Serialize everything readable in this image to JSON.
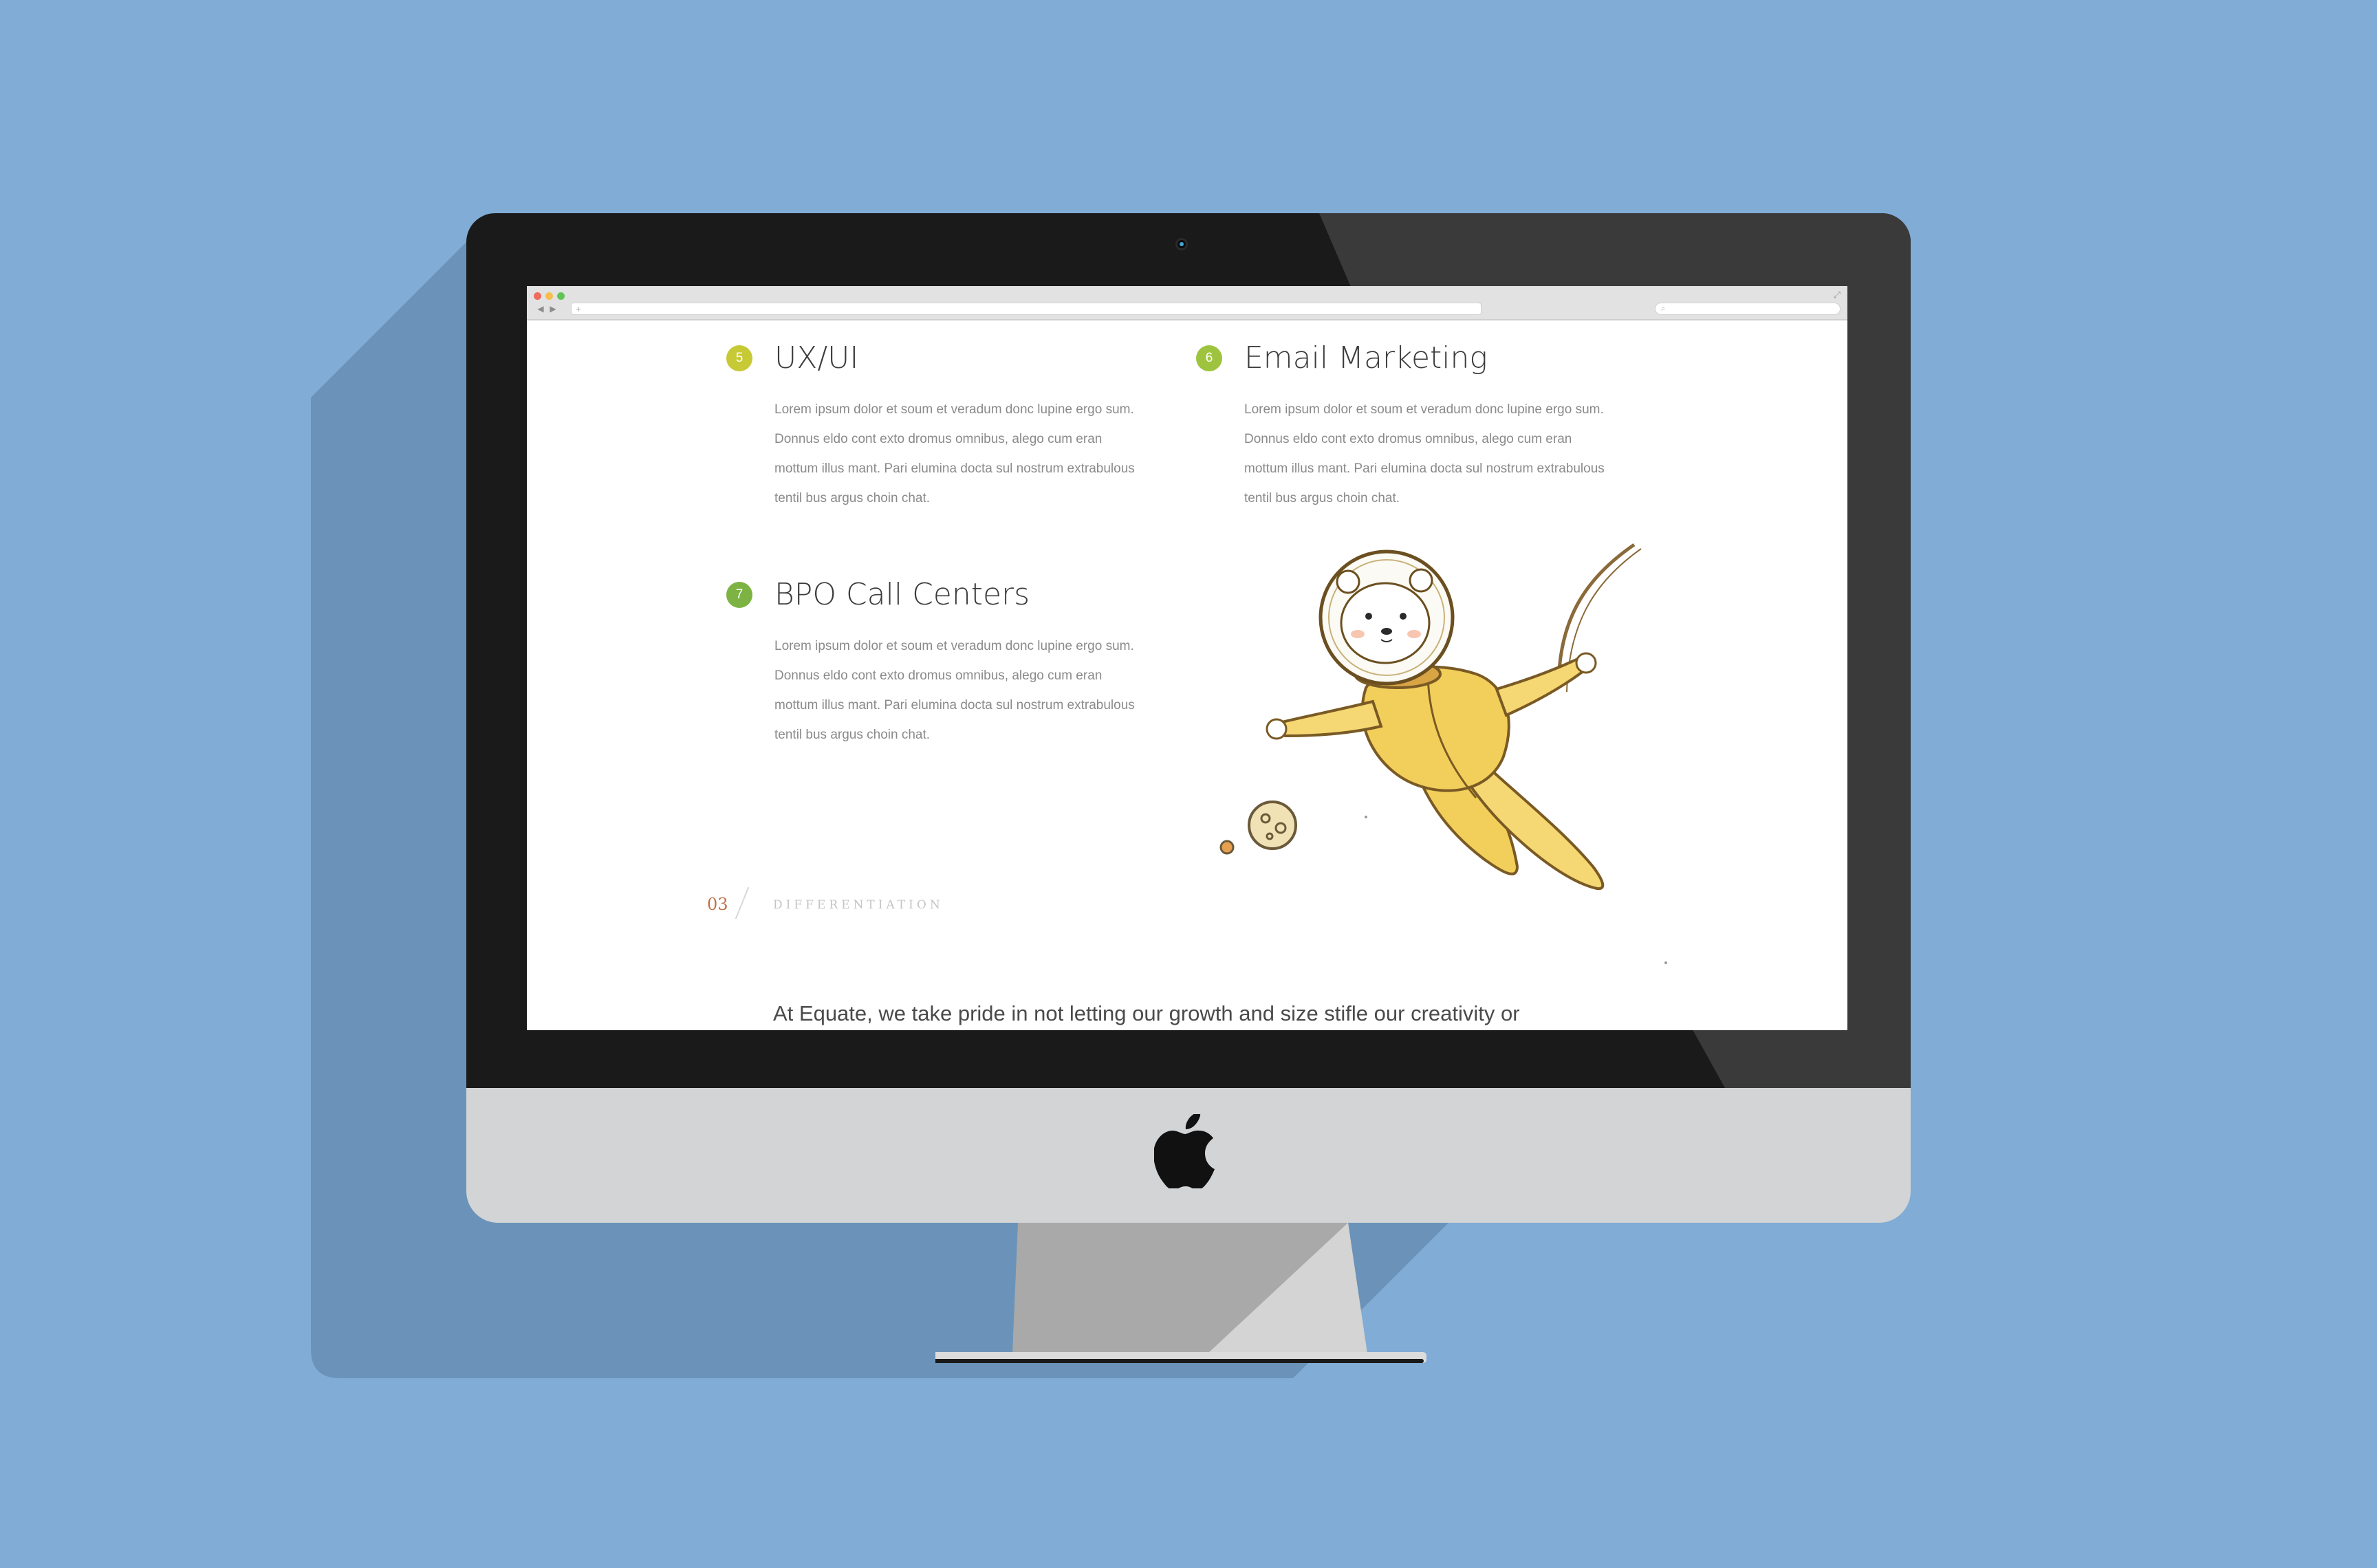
{
  "colors": {
    "background": "#80acd6",
    "bezel": "#1a1a1a",
    "chin": "#d2d4d6",
    "badge_5": "#c7c935",
    "badge_6": "#9ec43f",
    "badge_7": "#7cb342",
    "section_number": "#c0714a",
    "astronaut_suit": "#f2cf5b"
  },
  "browser": {
    "url_plus": "+",
    "back_glyph": "◀",
    "forward_glyph": "▶",
    "search_glyph": "⌕",
    "fullscreen_glyph": "⤢"
  },
  "services": [
    {
      "number": "5",
      "title": "UX/UI",
      "body": "Lorem ipsum dolor et soum et veradum donc lupine ergo sum. Donnus eldo cont exto dromus omnibus, alego cum eran mottum illus mant. Pari elumina docta sul nostrum extrabulous tentil bus argus choin chat."
    },
    {
      "number": "6",
      "title": "Email Marketing",
      "body": "Lorem ipsum dolor et soum et veradum donc lupine ergo sum. Donnus eldo cont exto dromus omnibus, alego cum eran mottum illus mant. Pari elumina docta sul nostrum extrabulous tentil bus argus choin chat."
    },
    {
      "number": "7",
      "title": "BPO Call Centers",
      "body": "Lorem ipsum dolor et soum et veradum donc lupine ergo sum. Donnus eldo cont exto dromus omnibus, alego cum eran mottum illus mant. Pari elumina docta sul nostrum extrabulous tentil bus argus choin chat."
    }
  ],
  "section": {
    "number": "03",
    "label": "DIFFERENTIATION",
    "intro": "At Equate, we take pride in not letting our growth and size stifle our creativity or"
  },
  "icons": {
    "logo": "apple-logo",
    "illustration": "astronaut-bear-illustration"
  }
}
